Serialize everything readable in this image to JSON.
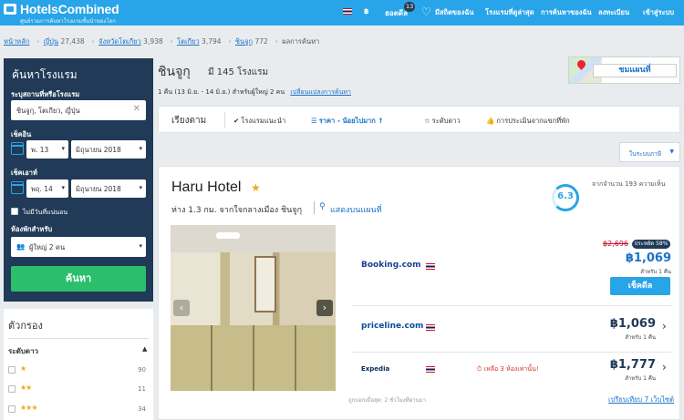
{
  "header": {
    "logo": "HotelsCombined",
    "tagline": "ศูนย์รวมการค้นหาโรงแรมชั้นนำของโลก",
    "currency": "฿",
    "deals_label": "ฮอตดีล",
    "deals_badge": "13",
    "favorites_label": "มีสถิตของฉัน",
    "nav": [
      "โรงแรมที่ดูล่าสุด",
      "การค้นหาของฉัน",
      "ลงทะเบียน",
      "เข้าสู่ระบบ"
    ]
  },
  "breadcrumb": [
    {
      "label": "หน้าหลัก",
      "count": ""
    },
    {
      "label": "ญี่ปุ่น",
      "count": "27,438"
    },
    {
      "label": "จังหวัดโตเกียว",
      "count": "3,938"
    },
    {
      "label": "โตเกียว",
      "count": "3,794"
    },
    {
      "label": "ชินจูกุ",
      "count": "772"
    }
  ],
  "breadcrumb_current": "ผลการค้นหา",
  "search": {
    "title": "ค้นหาโรงแรม",
    "destination_label": "ระบุสถานที่หรือโรงแรม",
    "destination_value": "ชินจูกุ, โตเกียว, ญี่ปุ่น",
    "checkin_label": "เช็คอิน",
    "checkin_day": "พ. 13",
    "checkin_month": "มิถุนายน 2018",
    "checkout_label": "เช็คเอาท์",
    "checkout_day": "พฤ. 14",
    "checkout_month": "มิถุนายน 2018",
    "no_dates_label": "ไม่มีวันที่แน่นอน",
    "guests_label": "ห้องพักสำหรับ",
    "guests_value": "ผู้ใหญ่ 2 คน",
    "button": "ค้นหา"
  },
  "filters": {
    "title": "ตัวกรอง",
    "star_title": "ระดับดาว",
    "rows": [
      {
        "stars": "★",
        "count": "90"
      },
      {
        "stars": "★★",
        "count": "11"
      },
      {
        "stars": "★★★",
        "count": "34"
      }
    ]
  },
  "results": {
    "title": "ชินจูกุ",
    "count": "มี 145 โรงแรม",
    "subtitle": "1 คืน (13 มิ.ย. - 14 มิ.ย.) สำหรับผู้ใหญ่ 2 คน",
    "change_link": "เปลี่ยนแปลงการค้นหา",
    "map_button": "ชมแผนที่"
  },
  "sort": {
    "lead": "เรียงตาม",
    "options": [
      {
        "label": "โรงแรมแนะนำ",
        "icon": "✔"
      },
      {
        "label": "ราคา - น้อยไปมาก",
        "icon": "☰"
      },
      {
        "label": "ระดับดาว",
        "icon": "☆"
      },
      {
        "label": "การประเมินจากแขกที่พัก",
        "icon": "👍"
      }
    ],
    "dropdown": "ในระบบภาษี"
  },
  "hotel": {
    "name": "Haru Hotel",
    "star": "★",
    "distance": "ห่าง 1.3 กม. จากใจกลางเมือง ชินจูกุ",
    "map_link": "แสดงบนแผนที่",
    "rating": "6.3",
    "rating_text": "จากจำนวน 193 ความเห็น",
    "deals": [
      {
        "vendor": "Booking.com",
        "strike": "฿2,696",
        "discount": "ประหยัด 58%",
        "price": "฿1,069",
        "per_night": "สำหรับ 1 คืน",
        "button": "เช็คดีล"
      },
      {
        "vendor": "priceline.com",
        "price": "฿1,069",
        "per_night": "สำหรับ 1 คืน"
      },
      {
        "vendor": "Expedia",
        "rooms_left": "เหลือ 3 ห้องเท่านั้น!",
        "price": "฿1,777",
        "per_night": "สำหรับ 1 คืน"
      }
    ],
    "foot_note": "ถูกบอกเมื่อสุด: 2 ชั่วโมงที่ผ่านมา",
    "compare_link": "เปรียบเทียบ 7 เว็บไซต์"
  },
  "colors": {
    "brand_blue": "#28a4e8",
    "panel_navy": "#203a57",
    "search_green": "#2bbf6b",
    "link_blue": "#1a73c8"
  }
}
